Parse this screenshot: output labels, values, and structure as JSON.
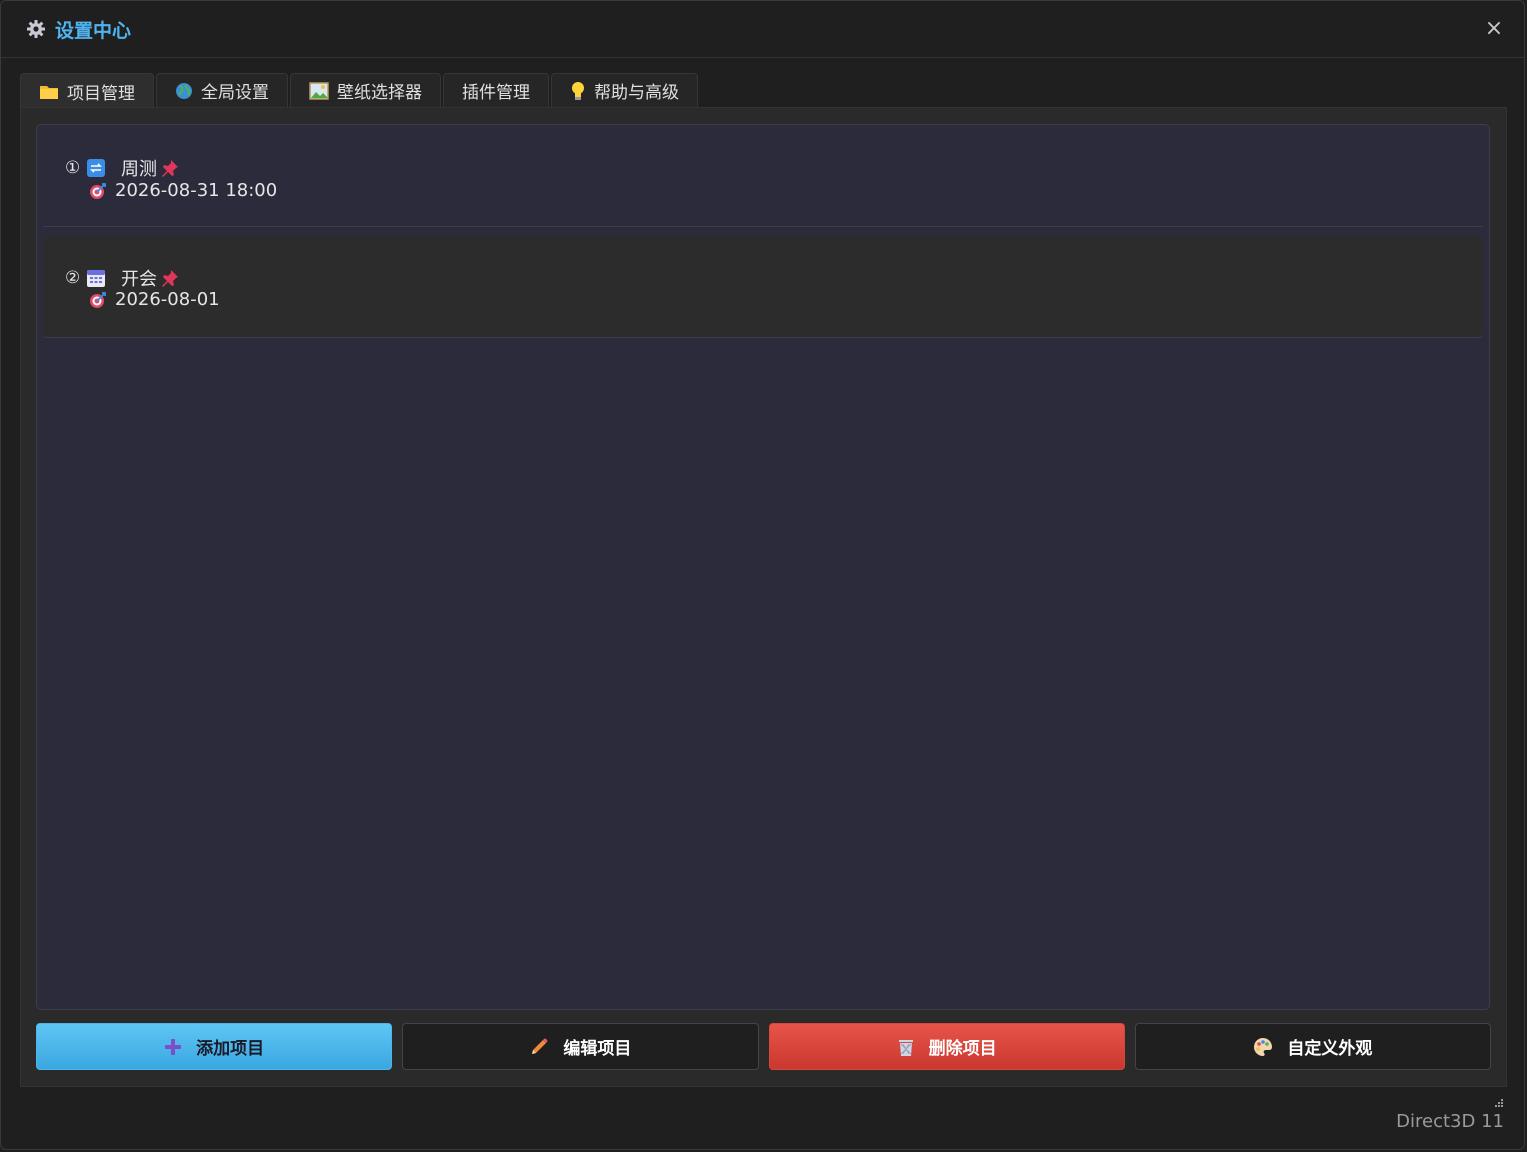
{
  "window": {
    "title": "设置中心",
    "close_label": "×"
  },
  "tabs": [
    {
      "label": "项目管理",
      "icon": "folder-icon"
    },
    {
      "label": "全局设置",
      "icon": "globe-icon"
    },
    {
      "label": "壁纸选择器",
      "icon": "picture-icon"
    },
    {
      "label": "插件管理",
      "icon": ""
    },
    {
      "label": "帮助与高级",
      "icon": "lightbulb-icon"
    }
  ],
  "items": [
    {
      "index": "①",
      "type_icon": "repeat-icon",
      "name": "周测",
      "pin_icon": "pin-icon",
      "date_icon": "target-icon",
      "date": "2026-08-31 18:00"
    },
    {
      "index": "②",
      "type_icon": "calendar-icon",
      "name": "开会",
      "pin_icon": "pin-icon",
      "date_icon": "target-icon",
      "date": "2026-08-01"
    }
  ],
  "buttons": {
    "add": "添加项目",
    "edit": "编辑项目",
    "delete": "删除项目",
    "customize": "自定义外观"
  },
  "status": "Direct3D 11",
  "colors": {
    "accent": "#4fb4f0",
    "add_button": "#4ab6ec",
    "delete_button": "#d9453b",
    "pin": "#e0365a"
  }
}
